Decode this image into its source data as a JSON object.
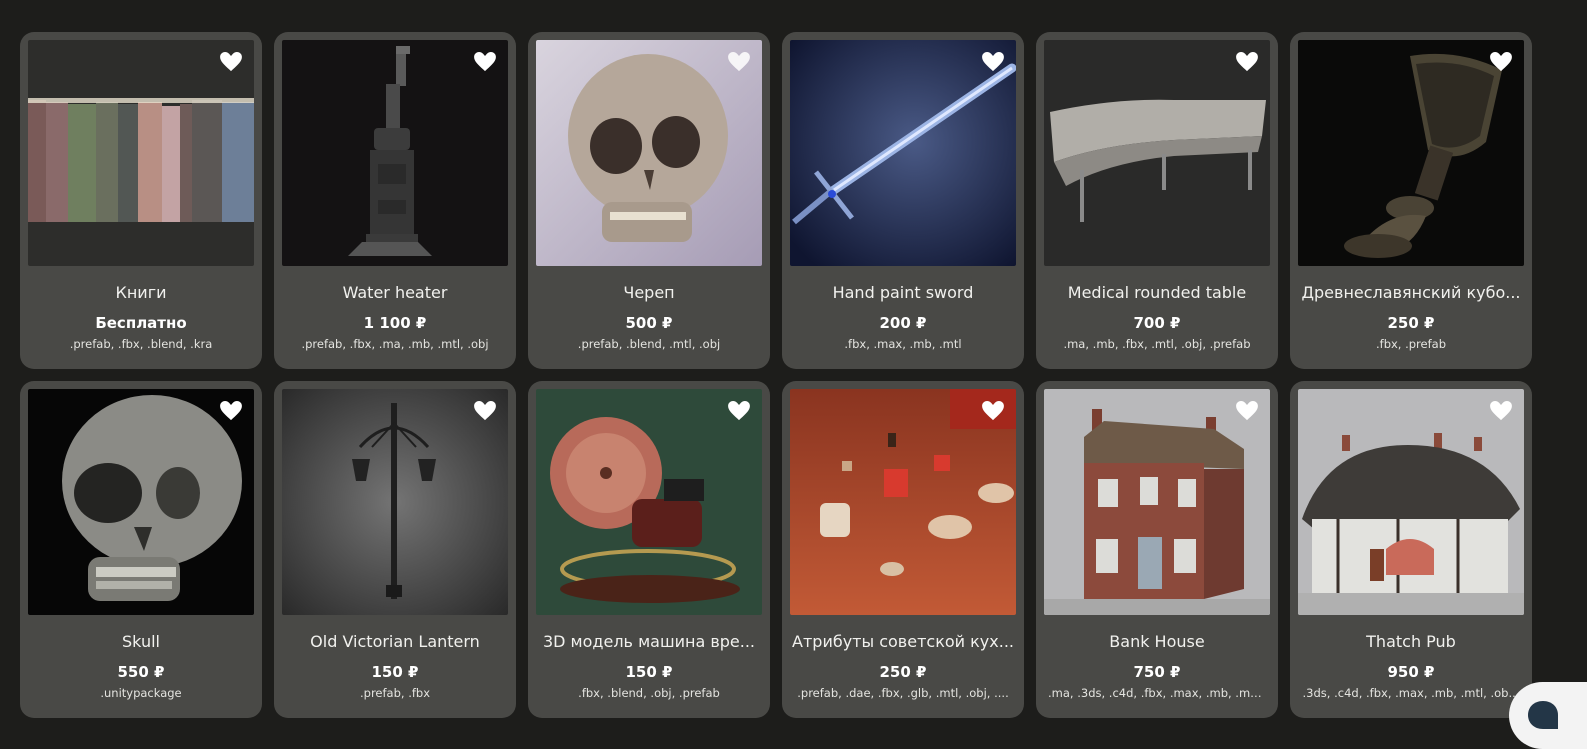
{
  "products": [
    {
      "title": "Книги",
      "price": "Бесплатно",
      "formats": ".prefab, .fbx, .blend, .kra",
      "favorite_icon": "heart-icon"
    },
    {
      "title": "Water heater",
      "price": "1 100 ₽",
      "formats": ".prefab, .fbx, .ma, .mb, .mtl, .obj",
      "favorite_icon": "heart-icon"
    },
    {
      "title": "Череп",
      "price": "500 ₽",
      "formats": ".prefab, .blend, .mtl, .obj",
      "favorite_icon": "heart-icon"
    },
    {
      "title": "Hand paint sword",
      "price": "200 ₽",
      "formats": ".fbx, .max, .mb, .mtl",
      "favorite_icon": "heart-icon"
    },
    {
      "title": "Medical rounded table",
      "price": "700 ₽",
      "formats": ".ma, .mb, .fbx, .mtl, .obj, .prefab",
      "favorite_icon": "heart-icon"
    },
    {
      "title": "Древнеславянский кубо...",
      "price": "250 ₽",
      "formats": ".fbx, .prefab",
      "favorite_icon": "heart-icon"
    },
    {
      "title": "Skull",
      "price": "550 ₽",
      "formats": ".unitypackage",
      "favorite_icon": "heart-icon"
    },
    {
      "title": "Old Victorian Lantern",
      "price": "150 ₽",
      "formats": ".prefab, .fbx",
      "favorite_icon": "heart-icon"
    },
    {
      "title": "3D модель машина вре...",
      "price": "150 ₽",
      "formats": ".fbx, .blend, .obj, .prefab",
      "favorite_icon": "heart-icon"
    },
    {
      "title": "Атрибуты советской кух...",
      "price": "250 ₽",
      "formats": ".prefab, .dae, .fbx, .glb, .mtl, .obj, ....",
      "favorite_icon": "heart-icon"
    },
    {
      "title": "Bank House",
      "price": "750 ₽",
      "formats": ".ma, .3ds, .c4d, .fbx, .max, .mb, .mtl...",
      "favorite_icon": "heart-icon"
    },
    {
      "title": "Thatch Pub",
      "price": "950 ₽",
      "formats": ".3ds, .c4d, .fbx, .max, .mb, .mtl, .ob...",
      "favorite_icon": "heart-icon"
    }
  ],
  "chat_button": {
    "icon": "chat-icon"
  },
  "colors": {
    "background": "#1d1d1b",
    "card": "#494946",
    "text": "#f1f1ee"
  }
}
